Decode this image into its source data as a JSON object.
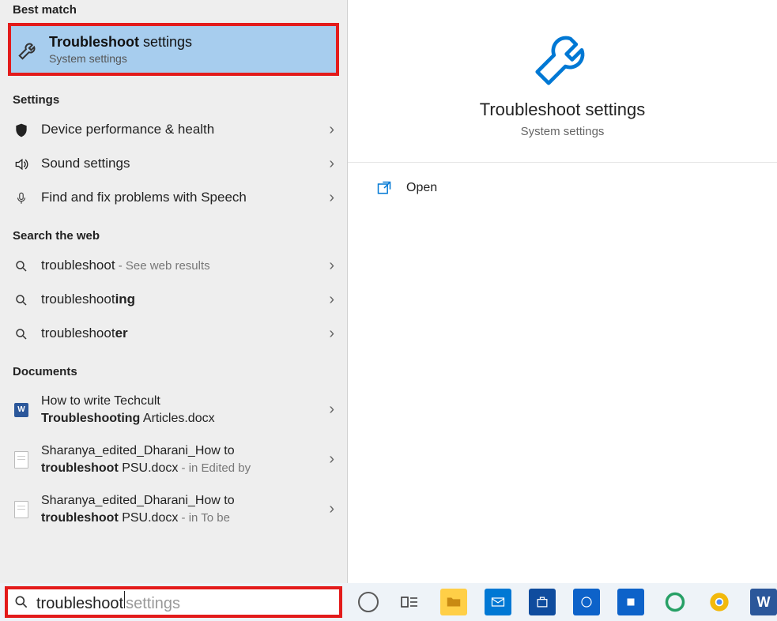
{
  "sections": {
    "best_match_header": "Best match",
    "settings_header": "Settings",
    "web_header": "Search the web",
    "documents_header": "Documents"
  },
  "best_match": {
    "title_bold": "Troubleshoot",
    "title_rest": " settings",
    "subtitle": "System settings"
  },
  "settings": [
    {
      "label": "Device performance & health",
      "icon": "shield"
    },
    {
      "label": "Sound settings",
      "icon": "sound"
    },
    {
      "label": "Find and fix problems with Speech",
      "icon": "mic"
    }
  ],
  "web": [
    {
      "prefix": "troubleshoot",
      "bold": "",
      "suffix": " - See web results"
    },
    {
      "prefix": "troubleshoot",
      "bold": "ing",
      "suffix": ""
    },
    {
      "prefix": "troubleshoot",
      "bold": "er",
      "suffix": ""
    }
  ],
  "documents": [
    {
      "line1": "How to write Techcult ",
      "line2_pre": "",
      "line2_bold": "Troubleshooting",
      "line2_post": " Articles.docx",
      "meta": "",
      "icon": "word"
    },
    {
      "line1": "Sharanya_edited_Dharani_How to ",
      "line2_pre": "",
      "line2_bold": "troubleshoot",
      "line2_post": " PSU.docx",
      "meta": " - in Edited by",
      "icon": "generic"
    },
    {
      "line1": "Sharanya_edited_Dharani_How to ",
      "line2_pre": "",
      "line2_bold": "troubleshoot",
      "line2_post": " PSU.docx",
      "meta": " - in To be",
      "icon": "generic"
    }
  ],
  "preview": {
    "title": "Troubleshoot settings",
    "subtitle": "System settings",
    "open_label": "Open"
  },
  "search": {
    "typed": "troubleshoot",
    "ghost": " settings"
  }
}
